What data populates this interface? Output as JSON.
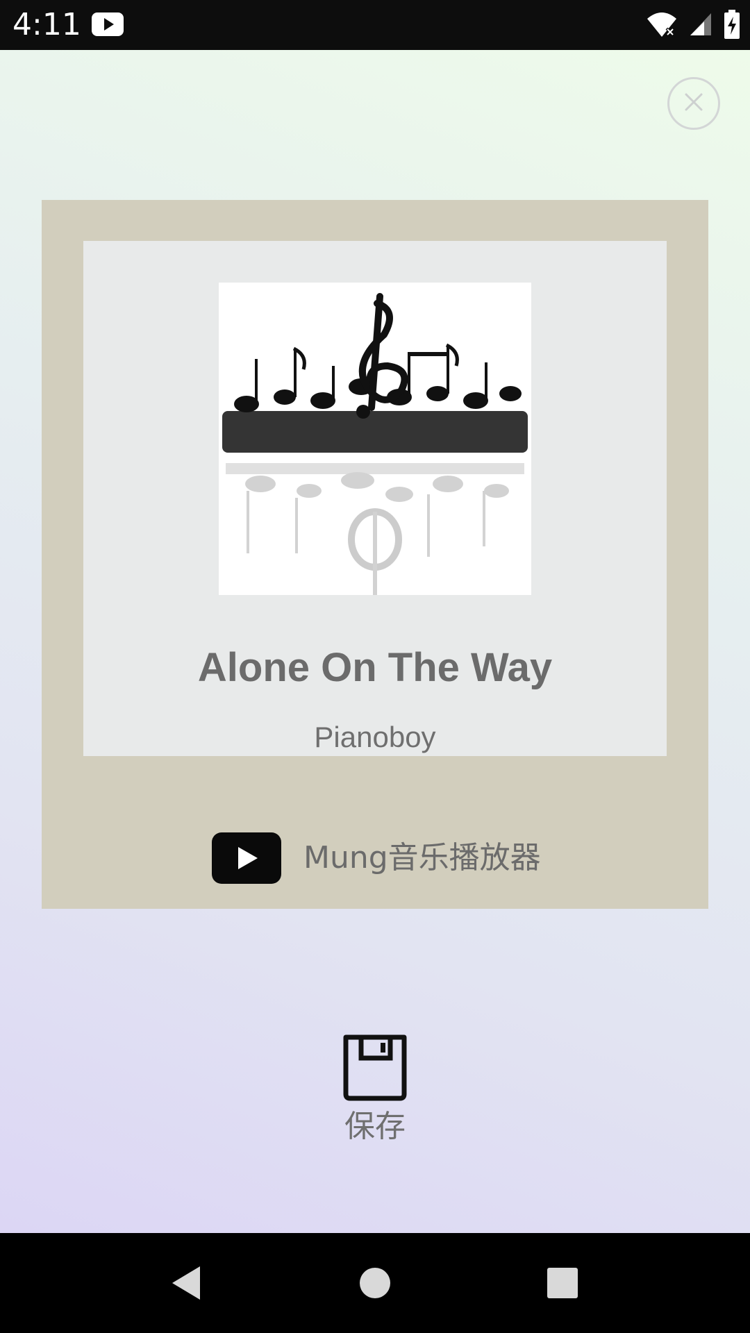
{
  "status_bar": {
    "time": "4:11",
    "icons": [
      "youtube-notification-icon",
      "wifi-icon",
      "signal-icon",
      "battery-icon"
    ]
  },
  "share_card": {
    "song_title": "Alone On The Way",
    "artist": "Pianoboy",
    "brand_name": "Mung音乐播放器",
    "album_art": "music-notes-artwork"
  },
  "actions": {
    "save_label": "保存"
  },
  "nav_bar": {
    "icons": [
      "back-icon",
      "home-icon",
      "recents-icon"
    ]
  },
  "colors": {
    "card_frame": "#d2cebd",
    "card_inner": "#e8eaea",
    "text_gray": "#6b6b6b"
  }
}
